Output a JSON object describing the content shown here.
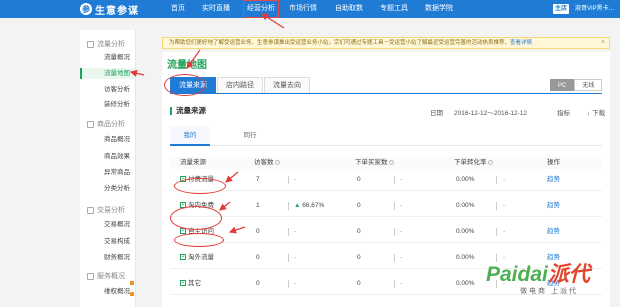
{
  "topnav": {
    "logo_text": "生意参谋",
    "items": [
      "首页",
      "实时直播",
      "经营分析",
      "市场行情",
      "自助取数",
      "专题工具",
      "数据学院"
    ],
    "user_badge": "主店",
    "user_name": "淑哥VIP黑卡…"
  },
  "sidebar": {
    "groups": [
      {
        "label": "流量分析",
        "items": [
          "流量概况",
          "流量地图",
          "访客分析",
          "装修分析"
        ]
      },
      {
        "label": "商品分析",
        "items": [
          "商品概况",
          "商品效果",
          "异常商品",
          "分类分析"
        ]
      },
      {
        "label": "交易分析",
        "items": [
          "交易概况",
          "交易构成",
          "财务概况"
        ]
      },
      {
        "label": "服务概况",
        "items": [
          "维权概况"
        ]
      }
    ],
    "active_item": "流量地图"
  },
  "notice": {
    "text": "为帮助您们更好地了解受运营业务，生意参谋推出受运营业务小站，宗们可通过专题工具－受运营小站了解最近受运营完善的活动热卖推荐，",
    "link": "查看详情",
    "close": "×"
  },
  "content": {
    "page_title": "流量地图",
    "tabs": [
      "流量来源",
      "店内路径",
      "流量去向"
    ],
    "toggle": [
      "PC",
      "无线"
    ],
    "section_title": "流量来源",
    "date_label": "日期",
    "date_range": "2016-12-12～2016-12-12",
    "metric_label": "指标",
    "download_label": "下载",
    "subtabs": [
      "我的",
      "同行"
    ],
    "table": {
      "headers": [
        "流量来源",
        "访客数",
        "下单买家数",
        "下单转化率",
        "操作"
      ],
      "rows": [
        {
          "source": "付费流量",
          "visitors": "7",
          "change": "-",
          "buyers": "0",
          "buyers_change": "-",
          "rate": "0.00%",
          "rate_change": "-",
          "action": "趋势"
        },
        {
          "source": "淘内免费",
          "visitors": "1",
          "change": "66.67%",
          "buyers": "0",
          "buyers_change": "-",
          "rate": "0.00%",
          "rate_change": "-",
          "action": "趋势"
        },
        {
          "source": "自主访问",
          "visitors": "0",
          "change": "-",
          "buyers": "0",
          "buyers_change": "-",
          "rate": "0.00%",
          "rate_change": "-",
          "action": "趋势"
        },
        {
          "source": "淘外流量",
          "visitors": "0",
          "change": "-",
          "buyers": "0",
          "buyers_change": "-",
          "rate": "0.00%",
          "rate_change": "-",
          "action": "趋势"
        },
        {
          "source": "其它",
          "visitors": "0",
          "change": "-",
          "buyers": "0",
          "buyers_change": "-",
          "rate": "0.00%",
          "rate_change": "-",
          "action": "趋势"
        }
      ]
    }
  },
  "watermark": {
    "brand_latin": "Paidai",
    "brand_cn": "派代",
    "tagline": "做电商 上派代"
  },
  "colors": {
    "nav_blue": "#1f7bd4",
    "accent_green": "#22a35b",
    "annotation_red": "#e23b3b"
  }
}
